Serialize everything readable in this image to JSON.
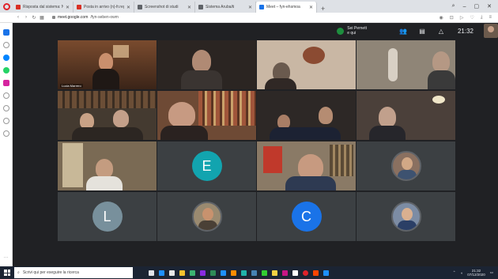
{
  "browser": {
    "tabs": [
      {
        "label": "Risposta dal sistema: Notif...",
        "color": "#d93025",
        "active": false
      },
      {
        "label": "Posta in arrivo (n)-fr.regine",
        "color": "#d93025",
        "active": false
      },
      {
        "label": "Screenshot di studi",
        "color": "#5f6368",
        "active": false
      },
      {
        "label": "Sistema Aruba/ti",
        "color": "#5f6368",
        "active": false
      },
      {
        "label": "Meet – fyn-ehsmoa",
        "color": "#1a73e8",
        "active": true
      }
    ],
    "url_host": "meet.google.com",
    "url_path": "/fyn-seben-owm"
  },
  "meet": {
    "presenter": {
      "line1": "Sei Pernett",
      "line2": "e qui"
    },
    "clock": "21:32",
    "tiles": [
      {
        "type": "video",
        "bg": "#5a3826",
        "label": "Lucia Marrero"
      },
      {
        "type": "video",
        "bg": "#2b2522",
        "label": ""
      },
      {
        "type": "video",
        "bg": "#c9b7a4",
        "label": ""
      },
      {
        "type": "video",
        "bg": "#8f8577",
        "label": ""
      },
      {
        "type": "video",
        "bg": "#443a30",
        "label": ""
      },
      {
        "type": "video",
        "bg": "#6e4a35",
        "label": ""
      },
      {
        "type": "video",
        "bg": "#2d2826",
        "label": ""
      },
      {
        "type": "video",
        "bg": "#4b403a",
        "label": ""
      },
      {
        "type": "video",
        "bg": "#7a6a54",
        "label": ""
      },
      {
        "type": "initial",
        "letter": "E",
        "color": "#12a4af"
      },
      {
        "type": "video",
        "bg": "#8a7a66",
        "label": ""
      },
      {
        "type": "photo"
      },
      {
        "type": "initial",
        "letter": "L",
        "color": "#78909c"
      },
      {
        "type": "photo"
      },
      {
        "type": "initial",
        "letter": "C",
        "color": "#1a73e8"
      },
      {
        "type": "photo"
      }
    ]
  },
  "taskbar": {
    "search_placeholder": "Scrivi qui per eseguire la ricerca",
    "tray_time": "21:32",
    "tray_date": "07/12/2020"
  }
}
